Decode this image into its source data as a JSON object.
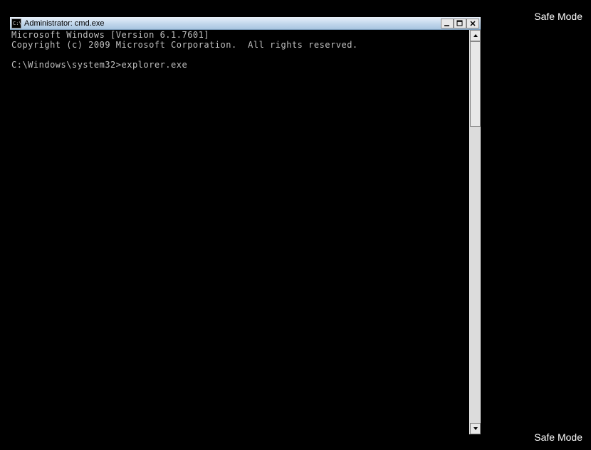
{
  "desktop": {
    "safe_mode_label_top": "Safe Mode",
    "safe_mode_label_bottom": "Safe Mode"
  },
  "window": {
    "title": "Administrator: cmd.exe",
    "icon_text": "C:\\"
  },
  "console": {
    "line1": "Microsoft Windows [Version 6.1.7601]",
    "line2": "Copyright (c) 2009 Microsoft Corporation.  All rights reserved.",
    "blank": "",
    "prompt": "C:\\Windows\\system32>",
    "command": "explorer.exe"
  }
}
